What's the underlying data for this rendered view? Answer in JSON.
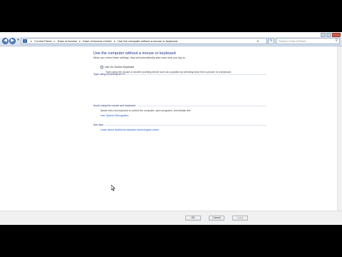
{
  "nav": {
    "back_glyph": "◀",
    "forward_glyph": "▶",
    "history_glyph": "▾",
    "breadcrumb": [
      "Control Panel",
      "Ease of Access",
      "Ease of Access Center",
      "Use the computer without a mouse or keyboard"
    ],
    "separator": "▸",
    "address_dropdown_glyph": "▾",
    "refresh_glyph": "↻",
    "search_placeholder": "Search Control Panel",
    "search_icon_glyph": "⚲"
  },
  "page": {
    "title": "Use the computer without a mouse or keyboard",
    "subtitle": "When you select these settings, they will automatically start each time you log on."
  },
  "section_pointing": {
    "header": "Type using a pointing device",
    "checkbox_label": "Use On-Screen Keyboard",
    "checkbox_checked": false,
    "description": "Type using the mouse or another pointing device such as a joystick by selecting keys from a picture of a keyboard."
  },
  "section_speech": {
    "header": "Avoid using the mouse and keyboard",
    "description": "Speak into a microphone to control the computer, open programs, and dictate text.",
    "link": "Use Speech Recognition"
  },
  "section_see_also": {
    "header": "See also",
    "link": "Learn about additional assistive technologies online"
  },
  "footer": {
    "ok": "OK",
    "cancel": "Cancel",
    "apply": "Apply"
  },
  "colors": {
    "heading": "#1e3287",
    "link": "#1f5bc6"
  }
}
